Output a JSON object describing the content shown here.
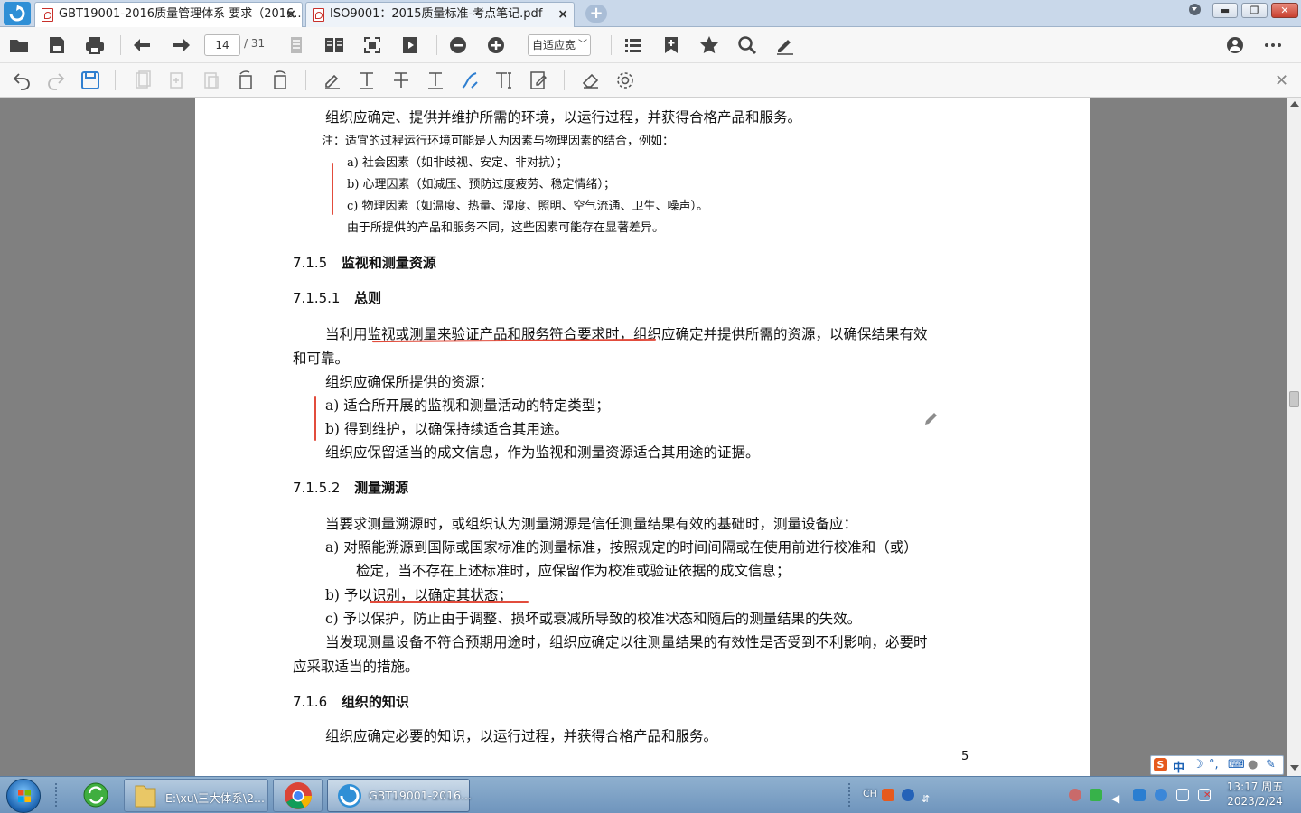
{
  "tabs": [
    {
      "title": "GBT19001-2016质量管理体系  要求（2016..."
    },
    {
      "title": "ISO9001：2015质量标准-考点笔记.pdf"
    }
  ],
  "toolbar": {
    "page_current": "14",
    "page_total": "/ 31",
    "zoom": "自适应宽"
  },
  "document": {
    "lines_top": [
      "组织应确定、提供并维护所需的环境，以运行过程，并获得合格产品和服务。",
      "注：适宜的过程运行环境可能是人为因素与物理因素的结合，例如：",
      "a)   社会因素（如非歧视、安定、非对抗）；",
      "b)   心理因素（如减压、预防过度疲劳、稳定情绪）；",
      "c)   物理因素（如温度、热量、湿度、照明、空气流通、卫生、噪声）。",
      "由于所提供的产品和服务不同，这些因素可能存在显著差异。"
    ],
    "h_715": {
      "num": "7.1.5",
      "title": "监视和测量资源"
    },
    "h_7151": {
      "num": "7.1.5.1",
      "title": "总则"
    },
    "p_7151_a1": "当利用",
    "p_7151_a2": "监视或测量来验证产品和服务符合要求时",
    "p_7151_a3": "，组织应确定并提供所需的资源，以确保结果有效",
    "p_7151_b": "和可靠。",
    "p_7151_c": "组织应确保所提供的资源：",
    "p_7151_d": "a)   适合所开展的监视和测量活动的特定类型；",
    "p_7151_e": "b)   得到维护，以确保持续适合其用途。",
    "p_7151_f": "组织应保留适当的成文信息，作为监视和测量资源适合其用途的证据。",
    "h_7152": {
      "num": "7.1.5.2",
      "title": "测量溯源"
    },
    "p_7152_a": "当要求测量溯源时，或组织认为测量溯源是信任测量结果有效的基础时，测量设备应：",
    "p_7152_b": "a)   对照能溯源到国际或国家标准的测量标准，按照规定的时间间隔或在使用前进行校准和（或）",
    "p_7152_c": "检定，当不存在上述标准时，应保留作为校准或验证依据的成文信息；",
    "p_7152_d1": "b)   予",
    "p_7152_d2": "以识别，以确定其状态；",
    "p_7152_e": "c)   予以保护，防止由于调整、损坏或衰减所导致的校准状态和随后的测量结果的失效。",
    "p_7152_f": "当发现测量设备不符合预期用途时，组织应确定以往测量结果的有效性是否受到不利影响，必要时",
    "p_7152_g": "应采取适当的措施。",
    "h_716": {
      "num": "7.1.6",
      "title": "组织的知识"
    },
    "p_716_a": "组织应确定必要的知识，以运行过程，并获得合格产品和服务。",
    "page_number": "5"
  },
  "ime": {
    "lang": "中"
  },
  "taskbar": {
    "explorer_label": "E:\\xu\\三大体系\\2...",
    "pdf_label": "GBT19001-2016...",
    "lang": "CH",
    "time": "13:17 周五",
    "date": "2023/2/24"
  },
  "colors": {
    "annotation_red": "#e24c3c",
    "tab_bar": "#c9d8ea",
    "taskbar": "#7fa2c6"
  }
}
